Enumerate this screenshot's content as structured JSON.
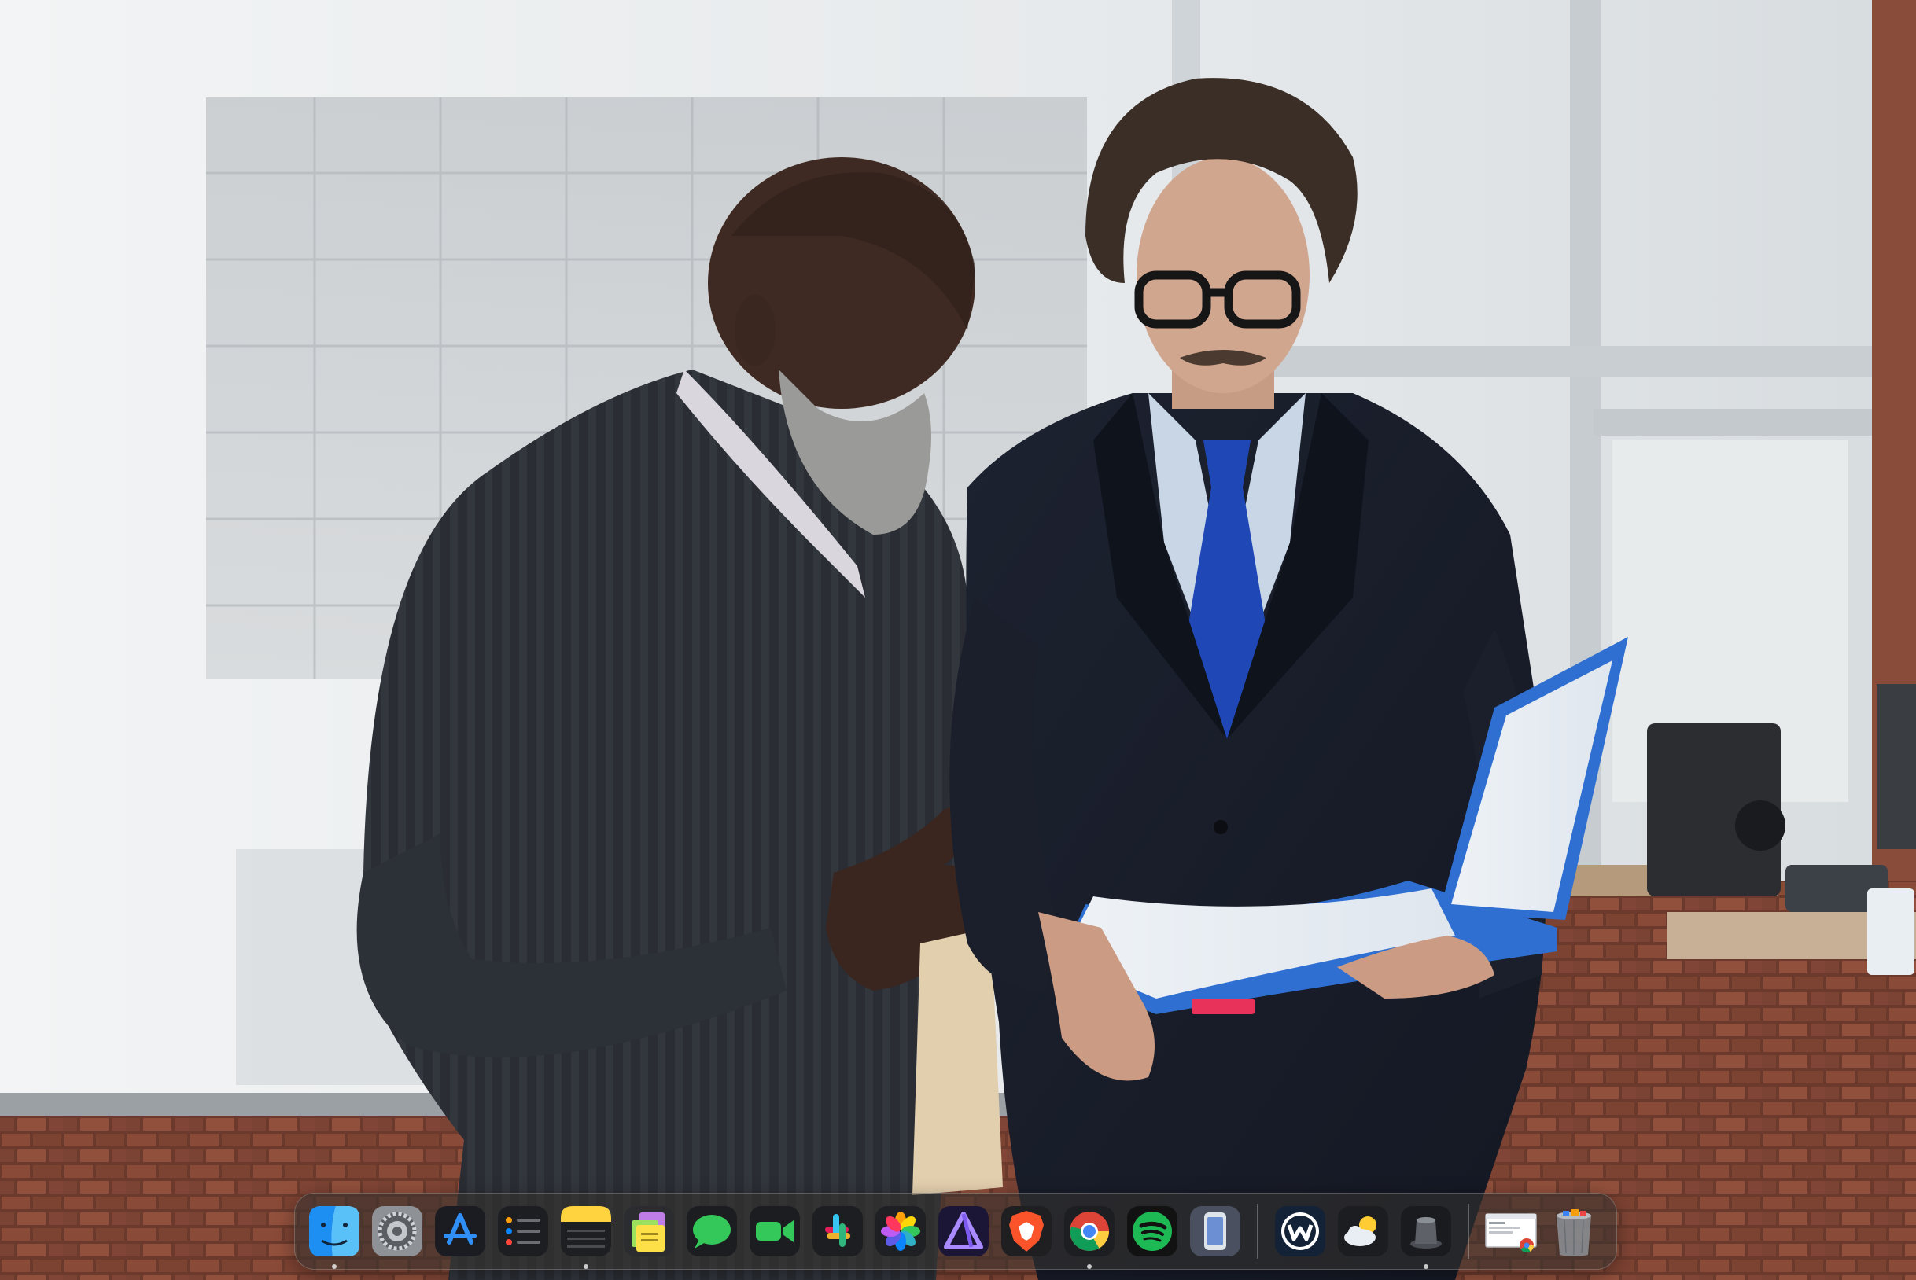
{
  "dock": {
    "apps": [
      {
        "name": "finder",
        "running": true
      },
      {
        "name": "system-settings",
        "running": false
      },
      {
        "name": "app-store",
        "running": false
      },
      {
        "name": "reminders",
        "running": false
      },
      {
        "name": "notes",
        "running": true
      },
      {
        "name": "stickies",
        "running": false
      },
      {
        "name": "messages",
        "running": false
      },
      {
        "name": "facetime",
        "running": false
      },
      {
        "name": "slack",
        "running": false
      },
      {
        "name": "photos",
        "running": false
      },
      {
        "name": "affinity",
        "running": false
      },
      {
        "name": "brave-browser",
        "running": false
      },
      {
        "name": "chrome",
        "running": true
      },
      {
        "name": "spotify",
        "running": false
      },
      {
        "name": "simulator",
        "running": false
      },
      {
        "name": "windscribe",
        "running": false
      },
      {
        "name": "weather",
        "running": false
      },
      {
        "name": "alfred-dark",
        "running": true
      },
      {
        "name": "chrome-window-preview",
        "running": false
      },
      {
        "name": "trash",
        "running": false
      }
    ]
  },
  "colors": {
    "finder_blue": "#1e8ff2",
    "messages_green": "#34c759",
    "spotify_green": "#1db954",
    "brave_orange": "#fb542b",
    "notes_yellow": "#ffd23f",
    "tie_blue": "#1f47b5",
    "folder_blue": "#2f6fd1"
  }
}
